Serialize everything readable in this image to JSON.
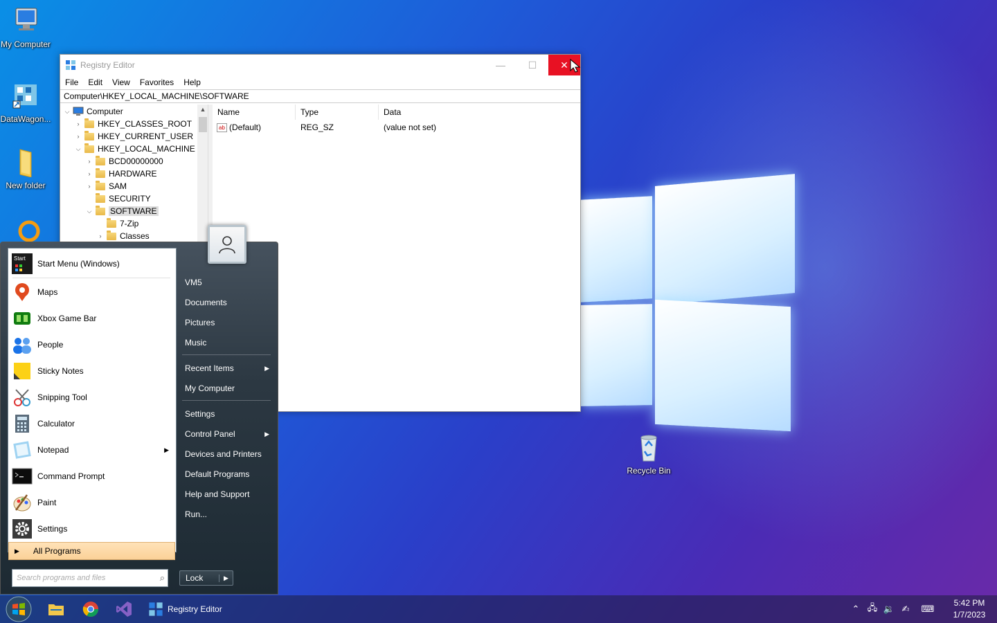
{
  "desktop": {
    "icons": [
      {
        "label": "My Computer"
      },
      {
        "label": "DataWagon..."
      },
      {
        "label": "New folder"
      },
      {
        "label": "Recycle Bin"
      }
    ]
  },
  "regedit": {
    "title": "Registry Editor",
    "menu": [
      "File",
      "Edit",
      "View",
      "Favorites",
      "Help"
    ],
    "address": "Computer\\HKEY_LOCAL_MACHINE\\SOFTWARE",
    "tree": {
      "root": "Computer",
      "hives": [
        "HKEY_CLASSES_ROOT",
        "HKEY_CURRENT_USER",
        "HKEY_LOCAL_MACHINE"
      ],
      "hklm_children": [
        "BCD00000000",
        "HARDWARE",
        "SAM",
        "SECURITY",
        "SOFTWARE"
      ],
      "software_children": [
        "7-Zip",
        "Classes"
      ]
    },
    "columns": [
      "Name",
      "Type",
      "Data"
    ],
    "values": [
      {
        "name": "(Default)",
        "type": "REG_SZ",
        "data": "(value not set)"
      }
    ]
  },
  "startmenu": {
    "pinned": [
      {
        "label": "Start Menu (Windows)",
        "icon": "start-menu-icon"
      }
    ],
    "programs": [
      {
        "label": "Maps",
        "icon": "maps-icon"
      },
      {
        "label": "Xbox Game Bar",
        "icon": "xbox-icon"
      },
      {
        "label": "People",
        "icon": "people-icon"
      },
      {
        "label": "Sticky Notes",
        "icon": "sticky-notes-icon"
      },
      {
        "label": "Snipping Tool",
        "icon": "scissors-icon"
      },
      {
        "label": "Calculator",
        "icon": "calculator-icon"
      },
      {
        "label": "Notepad",
        "icon": "notepad-icon"
      },
      {
        "label": "Command Prompt",
        "icon": "cmd-icon"
      },
      {
        "label": "Paint",
        "icon": "paint-icon"
      },
      {
        "label": "Settings",
        "icon": "gear-icon"
      }
    ],
    "all_programs": "All Programs",
    "search_placeholder": "Search programs and files",
    "right": {
      "user": "VM5",
      "documents": "Documents",
      "pictures": "Pictures",
      "music": "Music",
      "recent": "Recent Items",
      "computer": "My Computer",
      "settings": "Settings",
      "control_panel": "Control Panel",
      "devices": "Devices and Printers",
      "default_programs": "Default Programs",
      "help": "Help and Support",
      "run": "Run..."
    },
    "lock": "Lock",
    "start_icon_text": "Start"
  },
  "taskbar": {
    "apps": [
      {
        "label": "Registry Editor"
      }
    ],
    "clock": {
      "time": "5:42 PM",
      "date": "1/7/2023"
    }
  }
}
